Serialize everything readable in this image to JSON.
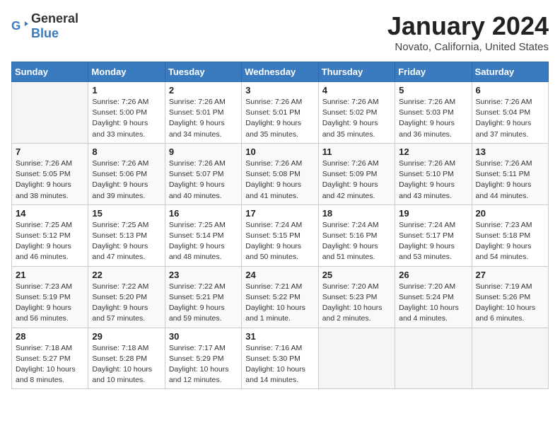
{
  "header": {
    "logo_general": "General",
    "logo_blue": "Blue",
    "title": "January 2024",
    "location": "Novato, California, United States"
  },
  "days_of_week": [
    "Sunday",
    "Monday",
    "Tuesday",
    "Wednesday",
    "Thursday",
    "Friday",
    "Saturday"
  ],
  "weeks": [
    [
      {
        "day": "",
        "content": ""
      },
      {
        "day": "1",
        "content": "Sunrise: 7:26 AM\nSunset: 5:00 PM\nDaylight: 9 hours\nand 33 minutes."
      },
      {
        "day": "2",
        "content": "Sunrise: 7:26 AM\nSunset: 5:01 PM\nDaylight: 9 hours\nand 34 minutes."
      },
      {
        "day": "3",
        "content": "Sunrise: 7:26 AM\nSunset: 5:01 PM\nDaylight: 9 hours\nand 35 minutes."
      },
      {
        "day": "4",
        "content": "Sunrise: 7:26 AM\nSunset: 5:02 PM\nDaylight: 9 hours\nand 35 minutes."
      },
      {
        "day": "5",
        "content": "Sunrise: 7:26 AM\nSunset: 5:03 PM\nDaylight: 9 hours\nand 36 minutes."
      },
      {
        "day": "6",
        "content": "Sunrise: 7:26 AM\nSunset: 5:04 PM\nDaylight: 9 hours\nand 37 minutes."
      }
    ],
    [
      {
        "day": "7",
        "content": "Sunrise: 7:26 AM\nSunset: 5:05 PM\nDaylight: 9 hours\nand 38 minutes."
      },
      {
        "day": "8",
        "content": "Sunrise: 7:26 AM\nSunset: 5:06 PM\nDaylight: 9 hours\nand 39 minutes."
      },
      {
        "day": "9",
        "content": "Sunrise: 7:26 AM\nSunset: 5:07 PM\nDaylight: 9 hours\nand 40 minutes."
      },
      {
        "day": "10",
        "content": "Sunrise: 7:26 AM\nSunset: 5:08 PM\nDaylight: 9 hours\nand 41 minutes."
      },
      {
        "day": "11",
        "content": "Sunrise: 7:26 AM\nSunset: 5:09 PM\nDaylight: 9 hours\nand 42 minutes."
      },
      {
        "day": "12",
        "content": "Sunrise: 7:26 AM\nSunset: 5:10 PM\nDaylight: 9 hours\nand 43 minutes."
      },
      {
        "day": "13",
        "content": "Sunrise: 7:26 AM\nSunset: 5:11 PM\nDaylight: 9 hours\nand 44 minutes."
      }
    ],
    [
      {
        "day": "14",
        "content": "Sunrise: 7:25 AM\nSunset: 5:12 PM\nDaylight: 9 hours\nand 46 minutes."
      },
      {
        "day": "15",
        "content": "Sunrise: 7:25 AM\nSunset: 5:13 PM\nDaylight: 9 hours\nand 47 minutes."
      },
      {
        "day": "16",
        "content": "Sunrise: 7:25 AM\nSunset: 5:14 PM\nDaylight: 9 hours\nand 48 minutes."
      },
      {
        "day": "17",
        "content": "Sunrise: 7:24 AM\nSunset: 5:15 PM\nDaylight: 9 hours\nand 50 minutes."
      },
      {
        "day": "18",
        "content": "Sunrise: 7:24 AM\nSunset: 5:16 PM\nDaylight: 9 hours\nand 51 minutes."
      },
      {
        "day": "19",
        "content": "Sunrise: 7:24 AM\nSunset: 5:17 PM\nDaylight: 9 hours\nand 53 minutes."
      },
      {
        "day": "20",
        "content": "Sunrise: 7:23 AM\nSunset: 5:18 PM\nDaylight: 9 hours\nand 54 minutes."
      }
    ],
    [
      {
        "day": "21",
        "content": "Sunrise: 7:23 AM\nSunset: 5:19 PM\nDaylight: 9 hours\nand 56 minutes."
      },
      {
        "day": "22",
        "content": "Sunrise: 7:22 AM\nSunset: 5:20 PM\nDaylight: 9 hours\nand 57 minutes."
      },
      {
        "day": "23",
        "content": "Sunrise: 7:22 AM\nSunset: 5:21 PM\nDaylight: 9 hours\nand 59 minutes."
      },
      {
        "day": "24",
        "content": "Sunrise: 7:21 AM\nSunset: 5:22 PM\nDaylight: 10 hours\nand 1 minute."
      },
      {
        "day": "25",
        "content": "Sunrise: 7:20 AM\nSunset: 5:23 PM\nDaylight: 10 hours\nand 2 minutes."
      },
      {
        "day": "26",
        "content": "Sunrise: 7:20 AM\nSunset: 5:24 PM\nDaylight: 10 hours\nand 4 minutes."
      },
      {
        "day": "27",
        "content": "Sunrise: 7:19 AM\nSunset: 5:26 PM\nDaylight: 10 hours\nand 6 minutes."
      }
    ],
    [
      {
        "day": "28",
        "content": "Sunrise: 7:18 AM\nSunset: 5:27 PM\nDaylight: 10 hours\nand 8 minutes."
      },
      {
        "day": "29",
        "content": "Sunrise: 7:18 AM\nSunset: 5:28 PM\nDaylight: 10 hours\nand 10 minutes."
      },
      {
        "day": "30",
        "content": "Sunrise: 7:17 AM\nSunset: 5:29 PM\nDaylight: 10 hours\nand 12 minutes."
      },
      {
        "day": "31",
        "content": "Sunrise: 7:16 AM\nSunset: 5:30 PM\nDaylight: 10 hours\nand 14 minutes."
      },
      {
        "day": "",
        "content": ""
      },
      {
        "day": "",
        "content": ""
      },
      {
        "day": "",
        "content": ""
      }
    ]
  ]
}
